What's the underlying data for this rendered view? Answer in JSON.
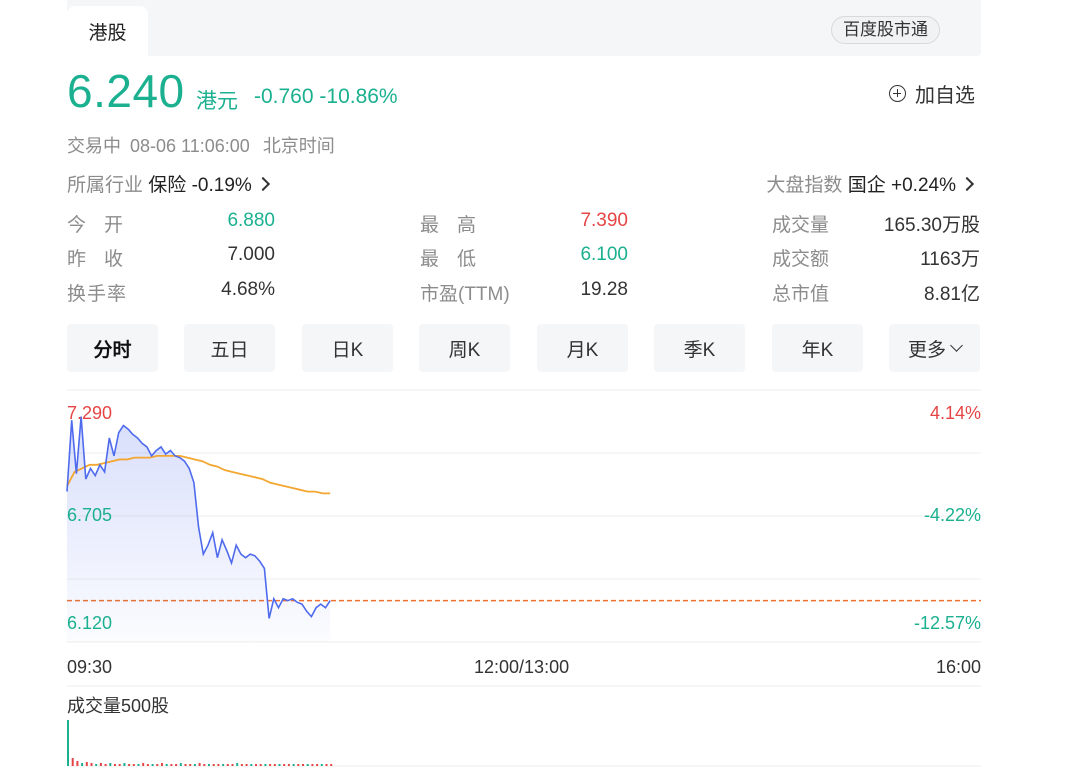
{
  "tabs": {
    "active": "港股",
    "brand": "百度股市通"
  },
  "quote": {
    "price": "6.240",
    "currency": "港元",
    "change": "-0.760",
    "change_pct": "-10.86%",
    "add_watch": "加自选"
  },
  "status": {
    "state": "交易中",
    "time": "08-06 11:06:00",
    "zone": "北京时间"
  },
  "industry": {
    "label": "所属行业",
    "name": "保险",
    "change": "-0.19%"
  },
  "market_index": {
    "label": "大盘指数",
    "name": "国企",
    "change": "+0.24%"
  },
  "stats": {
    "open": {
      "label": "今开",
      "value": "6.880"
    },
    "prev": {
      "label": "昨收",
      "value": "7.000"
    },
    "turnover_rate": {
      "label": "换手率",
      "value": "4.68%"
    },
    "high": {
      "label": "最高",
      "value": "7.390"
    },
    "low": {
      "label": "最低",
      "value": "6.100"
    },
    "pe": {
      "label": "市盈(TTM)",
      "value": "19.28"
    },
    "volume": {
      "label": "成交量",
      "value": "165.30万股"
    },
    "amount": {
      "label": "成交额",
      "value": "1163万"
    },
    "mktcap": {
      "label": "总市值",
      "value": "8.81亿"
    }
  },
  "periods": [
    "分时",
    "五日",
    "日K",
    "周K",
    "月K",
    "季K",
    "年K",
    "更多"
  ],
  "chart_data": {
    "type": "line",
    "y_left_ticks": [
      "7.290",
      "6.705",
      "6.120"
    ],
    "y_right_ticks": [
      "4.14%",
      "-4.22%",
      "-12.57%"
    ],
    "x_ticks": [
      "09:30",
      "12:00/13:00",
      "16:00"
    ],
    "ylim": [
      6.12,
      7.29
    ],
    "prev_close_ref": 6.24,
    "series": [
      {
        "values": [
          6.85,
          7.25,
          6.95,
          7.27,
          6.92,
          6.98,
          6.94,
          7.0,
          6.96,
          7.15,
          7.05,
          7.18,
          7.22,
          7.2,
          7.17,
          7.15,
          7.12,
          7.1,
          7.05,
          7.08,
          7.1,
          7.06,
          7.08,
          7.05,
          7.04,
          7.02,
          6.98,
          6.9,
          6.65,
          6.5,
          6.55,
          6.62,
          6.48,
          6.58,
          6.52,
          6.45,
          6.55,
          6.5,
          6.48,
          6.5,
          6.49,
          6.46,
          6.42,
          6.14,
          6.25,
          6.2,
          6.25,
          6.24,
          6.25,
          6.23,
          6.22,
          6.18,
          6.15,
          6.2,
          6.22,
          6.2,
          6.24
        ]
      },
      {
        "values": [
          6.88,
          6.96,
          6.98,
          7.0,
          7.0,
          7.01,
          7.02,
          7.03,
          7.03,
          7.04,
          7.04,
          7.04,
          7.05,
          7.05,
          7.05,
          7.05,
          7.04,
          7.03,
          7.02,
          7.0,
          6.99,
          6.97,
          6.96,
          6.95,
          6.94,
          6.93,
          6.92,
          6.9,
          6.89,
          6.88,
          6.87,
          6.86,
          6.85,
          6.85,
          6.84,
          6.84
        ]
      }
    ],
    "volume_label": "成交量500股"
  }
}
